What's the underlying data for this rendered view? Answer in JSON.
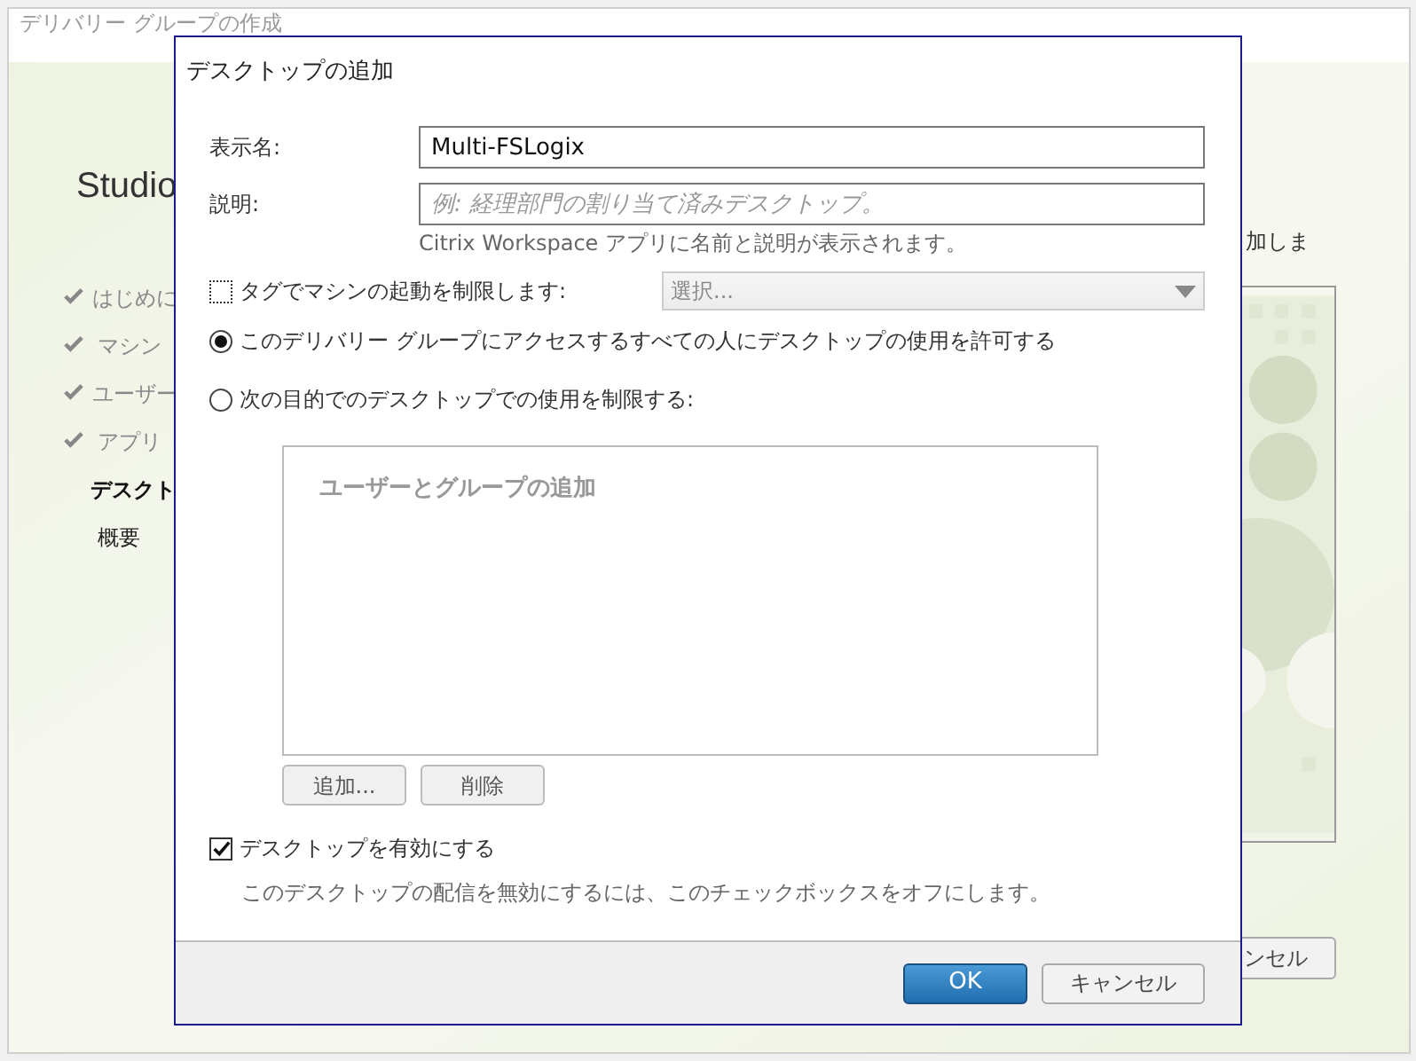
{
  "background_window": {
    "title": "デリバリー グループの作成",
    "heading": "Studio",
    "steps": [
      {
        "label": "はじめに",
        "done": true,
        "selected": false
      },
      {
        "label": "マシン",
        "done": true,
        "selected": false
      },
      {
        "label": "ユーザー",
        "done": true,
        "selected": false
      },
      {
        "label": "アプリ",
        "done": true,
        "selected": false
      },
      {
        "label": "デスクト",
        "done": false,
        "selected": true
      },
      {
        "label": "概要",
        "done": false,
        "selected": false
      }
    ],
    "side_text": "加しま",
    "cancel_button": "ンセル"
  },
  "dialog": {
    "title": "デスクトップの追加",
    "display_name": {
      "label": "表示名:",
      "value": "Multi-FSLogix"
    },
    "description": {
      "label": "説明:",
      "placeholder": "例: 経理部門の割り当て済みデスクトップ。",
      "hint": "Citrix Workspace アプリに名前と説明が表示されます。"
    },
    "restrict_by_tag": {
      "label": "タグでマシンの起動を制限します:",
      "checked": false,
      "select_placeholder": "選択..."
    },
    "access_options": [
      {
        "label": "このデリバリー グループにアクセスするすべての人にデスクトップの使用を許可する",
        "selected": true
      },
      {
        "label": "次の目的でのデスクトップでの使用を制限する:",
        "selected": false
      }
    ],
    "users_list": {
      "placeholder": "ユーザーとグループの追加"
    },
    "list_buttons": [
      "追加...",
      "削除"
    ],
    "enable_desktop": {
      "label": "デスクトップを有効にする",
      "checked": true,
      "hint": "このデスクトップの配信を無効にするには、このチェックボックスをオフにします。"
    },
    "buttons": [
      {
        "label": "OK",
        "primary": true
      },
      {
        "label": "キャンセル",
        "primary": false
      }
    ]
  }
}
